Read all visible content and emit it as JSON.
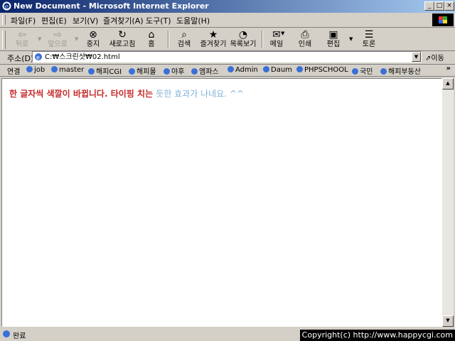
{
  "window": {
    "title": "New Document - Microsoft Internet Explorer"
  },
  "menu": [
    "파일(F)",
    "편집(E)",
    "보기(V)",
    "즐겨찾기(A)",
    "도구(T)",
    "도움말(H)"
  ],
  "toolbar": {
    "back": "뒤로",
    "forward": "앞으로",
    "stop": "중지",
    "refresh": "새로고침",
    "home": "홈",
    "search": "검색",
    "favorites": "즐겨찾기",
    "history": "목록보기",
    "mail": "메일",
    "print": "인쇄",
    "edit": "편집",
    "discuss": "토론"
  },
  "address": {
    "label": "주소(D)",
    "url": "C:₩스크린샷₩02.html",
    "go": "이동"
  },
  "links": {
    "label": "연결",
    "items": [
      "job",
      "master",
      "해피CGI",
      "해피몰",
      "야후",
      "엠파스",
      "Admin",
      "Daum",
      "PHPSCHOOL",
      "국민",
      "해피부동산"
    ]
  },
  "content": {
    "text_red": "한 글자씩 색깔이 바뀝니다. 타이핑 치는 ",
    "text_blue": "듯한 효과가 나네요. ^^"
  },
  "status": {
    "text": "완료"
  },
  "watermark": "Copyright(c) http://www.happycgi.com",
  "colors": {
    "text_red": "#c62828",
    "text_blue": "#7fb3d5",
    "titlebar": "#0a246a"
  }
}
